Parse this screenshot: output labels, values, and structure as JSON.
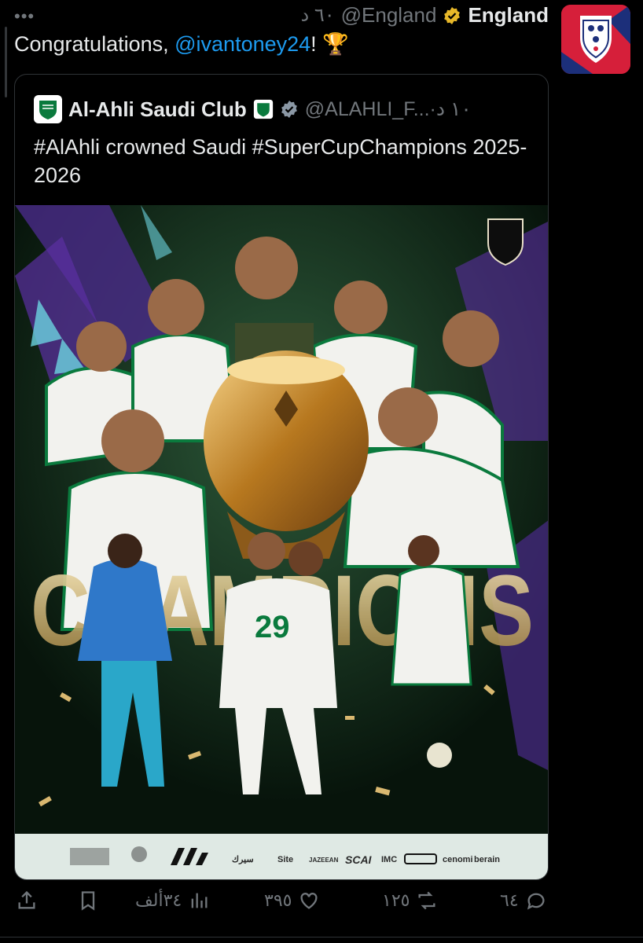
{
  "tweet": {
    "more_label": "•••",
    "time": "٦٠ د",
    "handle": "@England",
    "display_name": "England",
    "text_before": "Congratulations, ",
    "mention": "@ivantoney24",
    "text_after": "! 🏆"
  },
  "quote": {
    "display_name": "Al-Ahli Saudi Club",
    "handle_time": "@ALAHLI_F...·١٠ د",
    "text": "#AlAhli crowned Saudi #SuperCupChampions 2025-2026",
    "poster_word": "CHAMPIONS",
    "jersey_number": "29",
    "sponsors": [
      "سيرك",
      "Site",
      "JAZEEAN",
      "SCAI",
      "IMC",
      "cenomi",
      "berain"
    ]
  },
  "actions": {
    "replies": "٦٤",
    "retweets": "١٢٥",
    "likes": "٣٩٥",
    "views": "٣٤ألف"
  },
  "colors": {
    "link": "#1d9bf0",
    "muted": "#71767b",
    "verified_gold": "#e8b829",
    "verified_gray": "#8b98a5",
    "ahli_green": "#0a7a3d"
  },
  "icons": [
    "more-icon",
    "verified-gold-icon",
    "verified-gray-icon",
    "reply-icon",
    "retweet-icon",
    "like-icon",
    "views-icon",
    "bookmark-icon",
    "share-icon"
  ]
}
